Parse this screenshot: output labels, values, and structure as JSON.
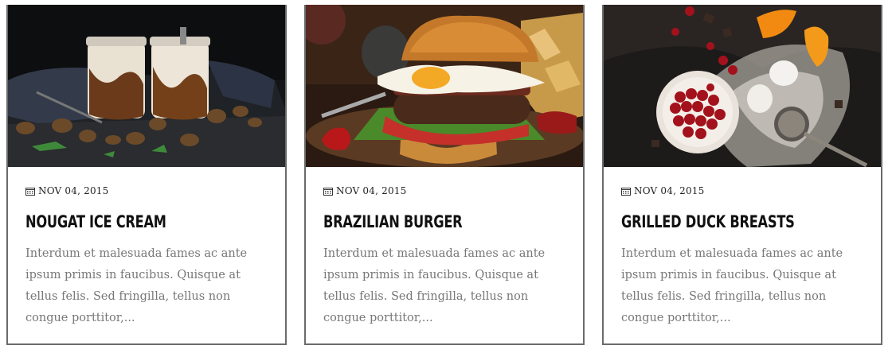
{
  "cards": [
    {
      "image": "nougat-ice-cream-jars-photo",
      "date": "NOV 04, 2015",
      "title": "NOUGAT ICE CREAM",
      "excerpt": "Interdum et malesuada fames ac ante ipsum primis in faucibus. Quisque at tellus felis. Sed fringilla, tellus non congue porttitor,..."
    },
    {
      "image": "burger-with-fried-egg-photo",
      "date": "NOV 04, 2015",
      "title": "BRAZILIAN BURGER",
      "excerpt": "Interdum et malesuada fames ac ante ipsum primis in faucibus. Quisque at tellus felis. Sed fringilla, tellus non congue porttitor,..."
    },
    {
      "image": "cherries-flour-oranges-photo",
      "date": "NOV 04, 2015",
      "title": "GRILLED DUCK BREASTS",
      "excerpt": "Interdum et malesuada fames ac ante ipsum primis in faucibus. Quisque at tellus felis. Sed fringilla, tellus non congue porttitor,..."
    }
  ],
  "icons": {
    "date": "calendar-icon"
  },
  "colors": {
    "border": "#6b6b6b",
    "title": "#111111",
    "excerpt": "#777777",
    "date": "#222222"
  }
}
